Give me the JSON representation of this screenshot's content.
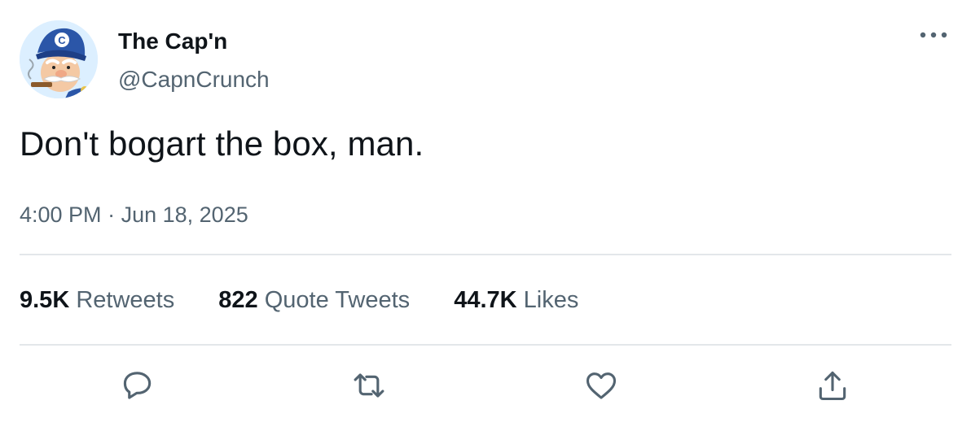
{
  "author": {
    "display_name": "The Cap'n",
    "handle": "@CapnCrunch",
    "avatar_icon": "cap-n-crunch-avatar-icon"
  },
  "tweet": {
    "text": "Don't bogart the box, man.",
    "time": "4:00 PM",
    "separator": "·",
    "date": "Jun 18, 2025"
  },
  "stats": {
    "retweets_count": "9.5K",
    "retweets_label": "Retweets",
    "quotes_count": "822",
    "quotes_label": "Quote Tweets",
    "likes_count": "44.7K",
    "likes_label": "Likes"
  },
  "actions": [
    {
      "name": "reply",
      "icon": "reply-icon"
    },
    {
      "name": "retweet",
      "icon": "retweet-icon"
    },
    {
      "name": "like",
      "icon": "heart-icon"
    },
    {
      "name": "share",
      "icon": "share-icon"
    }
  ],
  "colors": {
    "primary_text": "#0f1419",
    "secondary_text": "#536471",
    "divider": "#e3e7ea",
    "icon": "#536471"
  }
}
